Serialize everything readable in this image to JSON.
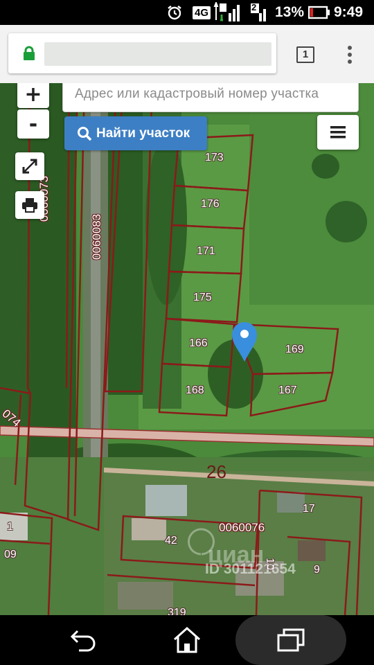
{
  "status_bar": {
    "network": "4G",
    "sim_slot": "2",
    "battery": "13%",
    "time": "9:49",
    "icons": [
      "alarm-icon",
      "signal-icon",
      "battery-icon"
    ]
  },
  "browser": {
    "url": "",
    "tab_count": "1",
    "icons": [
      "lock-icon",
      "overflow-menu-icon"
    ]
  },
  "map_controls": {
    "zoom_in": "+",
    "zoom_out": "-",
    "search_placeholder": "Адрес или кадастровый номер участка",
    "search_button": "Найти участок",
    "icons": [
      "fullscreen-icon",
      "print-icon",
      "hamburger-menu-icon",
      "search-icon",
      "location-pin-icon"
    ]
  },
  "map_labels": {
    "parcels": [
      "173",
      "176",
      "171",
      "175",
      "166",
      "169",
      "168",
      "167",
      "17",
      "42",
      "10",
      "9",
      "1",
      "09",
      "319"
    ],
    "blocks": [
      "0060073",
      "0060083",
      "0060076",
      "074"
    ],
    "quarter": "26"
  },
  "watermark": {
    "brand": "циан",
    "id_text": "ID 301121654"
  },
  "nav_bar": {
    "icons": [
      "back-icon",
      "home-icon",
      "recent-apps-icon"
    ]
  },
  "colors": {
    "status_bar_bg": "#000000",
    "browser_bar_bg": "#f2f2f2",
    "search_button_bg": "#3d7fc4",
    "parcel_border": "#8b1a1a",
    "road": "#d9b3a8",
    "lock_green": "#1a9e3a"
  }
}
